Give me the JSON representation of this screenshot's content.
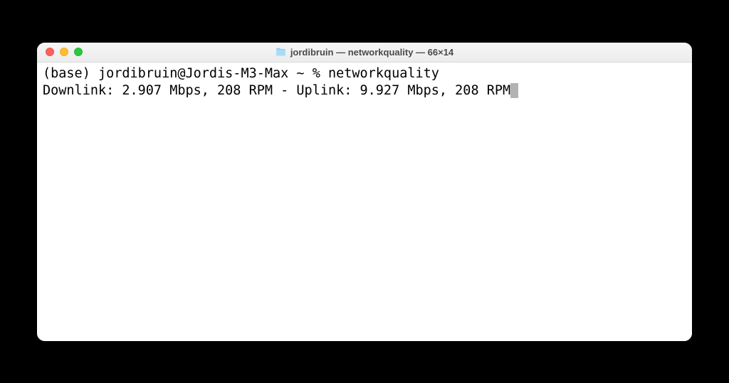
{
  "window": {
    "title": "jordibruin — networkquality — 66×14",
    "traffic_lights": {
      "close": "red",
      "minimize": "yellow",
      "zoom": "green"
    }
  },
  "terminal": {
    "lines": [
      "(base) jordibruin@Jordis-M3-Max ~ % networkquality",
      "Downlink: 2.907 Mbps, 208 RPM - Uplink: 9.927 Mbps, 208 RPM"
    ]
  }
}
